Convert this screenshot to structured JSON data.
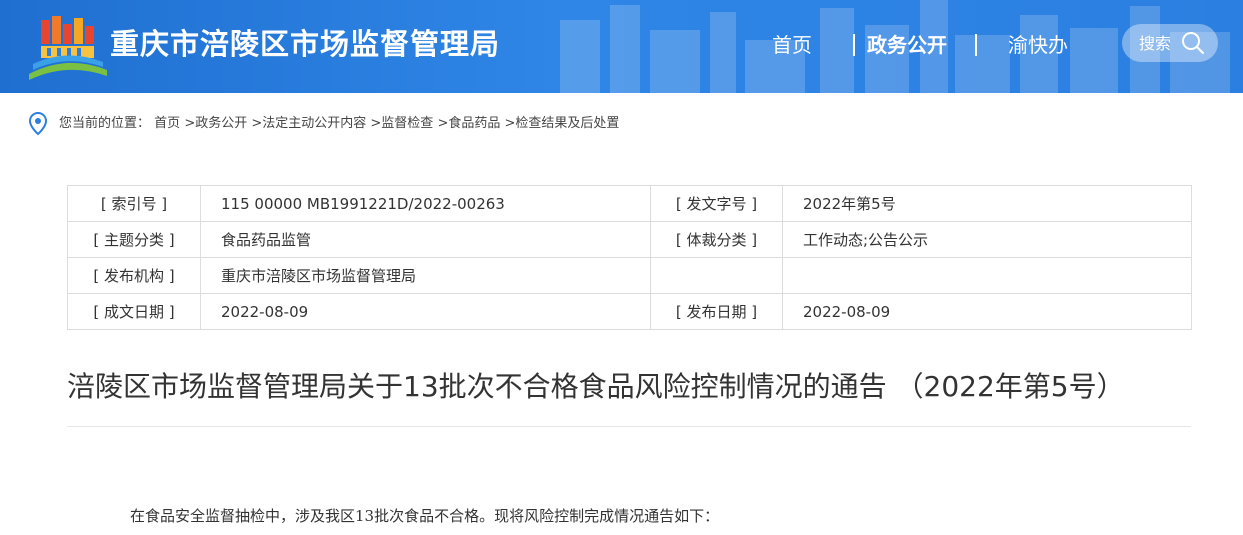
{
  "header": {
    "site_title": "重庆市涪陵区市场监督管理局",
    "nav": [
      {
        "label": "首页"
      },
      {
        "label": "政务公开"
      },
      {
        "label": "渝快办"
      }
    ],
    "search_label": "搜索"
  },
  "breadcrumb": {
    "prefix": "您当前的位置：",
    "items": [
      "首页",
      ">政务公开",
      ">法定主动公开内容",
      ">监督检查",
      ">食品药品",
      ">检查结果及后处置"
    ]
  },
  "meta": {
    "rows": [
      {
        "k1": "[ 索引号 ]",
        "v1": "115 00000 MB1991221D/2022-00263",
        "k2": "[ 发文字号 ]",
        "v2": "2022年第5号"
      },
      {
        "k1": "[ 主题分类 ]",
        "v1": "食品药品监管",
        "k2": "[ 体裁分类 ]",
        "v2": "工作动态;公告公示"
      },
      {
        "k1": "[ 发布机构 ]",
        "v1": "重庆市涪陵区市场监督管理局",
        "k2": "",
        "v2": ""
      },
      {
        "k1": "[ 成文日期 ]",
        "v1": "2022-08-09",
        "k2": "[ 发布日期 ]",
        "v2": "2022-08-09"
      }
    ]
  },
  "article": {
    "title": "涪陵区市场监督管理局关于13批次不合格食品风险控制情况的通告 （2022年第5号）",
    "intro": "在食品安全监督抽检中，涉及我区13批次食品不合格。现将风险控制完成情况通告如下："
  },
  "colors": {
    "header_blue": "#2b7fe0",
    "border": "#dcdcdc"
  }
}
